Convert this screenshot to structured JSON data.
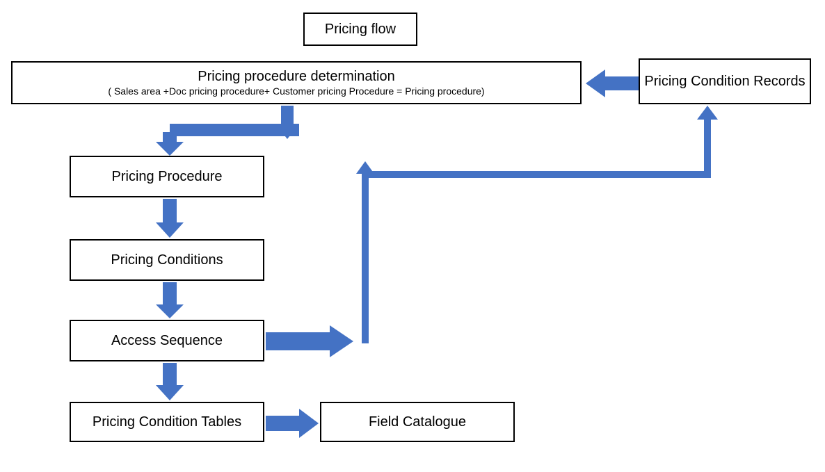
{
  "diagram": {
    "title": "Pricing flow",
    "determination": {
      "title": "Pricing procedure determination",
      "formula": "( Sales area +Doc pricing procedure+ Customer pricing Procedure = Pricing procedure)"
    },
    "records": "Pricing Condition Records",
    "procedure": "Pricing Procedure",
    "conditions": "Pricing Conditions",
    "access": "Access Sequence",
    "tables": "Pricing Condition Tables",
    "catalogue": "Field Catalogue"
  },
  "colors": {
    "arrow": "#4472c4",
    "border": "#000000",
    "background": "#ffffff"
  }
}
